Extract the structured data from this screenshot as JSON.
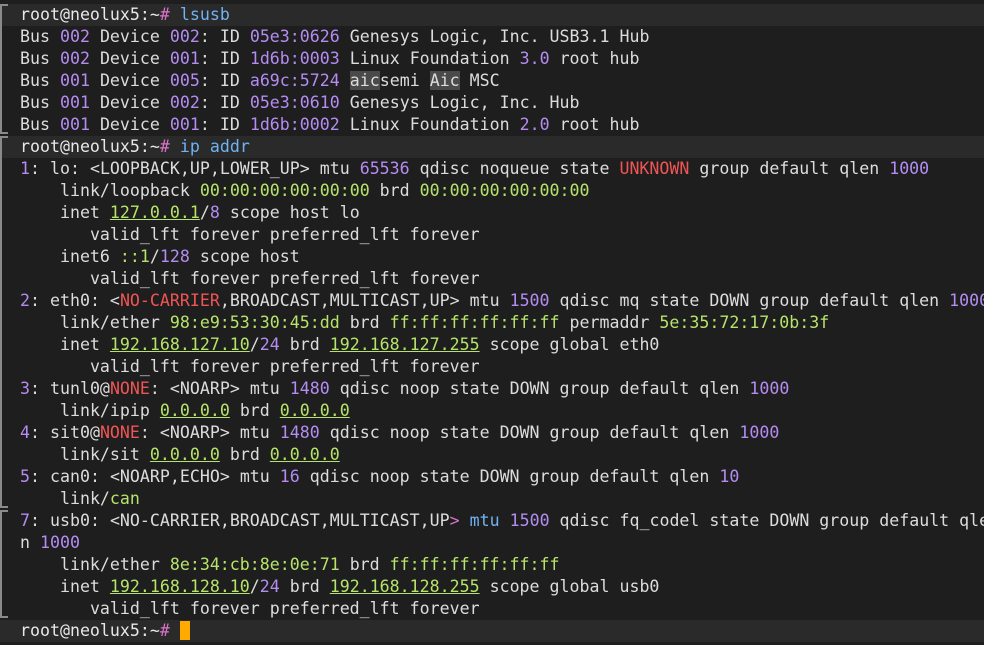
{
  "prompt": {
    "user_host": "root@neolux5:~",
    "symbol": "#"
  },
  "commands": {
    "lsusb": "lsusb",
    "ip_addr": "ip addr"
  },
  "lsusb": [
    {
      "bus": "002",
      "device": "002",
      "id": "05e3:0626",
      "desc": "Genesys Logic, Inc. USB3.1 Hub"
    },
    {
      "bus": "002",
      "device": "001",
      "id": "1d6b:0003",
      "desc_a": "Linux Foundation ",
      "ver": "3.0",
      "desc_b": " root hub"
    },
    {
      "bus": "001",
      "device": "005",
      "id": "a69c:5724",
      "vendor_hl": "aic",
      "vendor_rest": "semi",
      "prod_hl": "Aic",
      "prod_rest": " MSC"
    },
    {
      "bus": "001",
      "device": "002",
      "id": "05e3:0610",
      "desc": "Genesys Logic, Inc. Hub"
    },
    {
      "bus": "001",
      "device": "001",
      "id": "1d6b:0002",
      "desc_a": "Linux Foundation ",
      "ver": "2.0",
      "desc_b": " root hub"
    }
  ],
  "ip": {
    "lo": {
      "idx": "1",
      "name": "lo",
      "flags": "<LOOPBACK,UP,LOWER_UP>",
      "mtu": "65536",
      "qdisc_pre": " qdisc noqueue state ",
      "state": "UNKNOWN",
      "group": " group default qlen ",
      "qlen": "1000",
      "link": "link/loopback",
      "mac": "00:00:00:00:00:00",
      "brd": "00:00:00:00:00:00",
      "inet_addr": "127.0.0.1",
      "inet_pfx": "8",
      "inet_scope": " scope host lo",
      "valid": "valid_lft forever preferred_lft forever",
      "inet6_addr": "::1",
      "inet6_pfx": "128",
      "inet6_scope": " scope host"
    },
    "eth0": {
      "idx": "2",
      "name": "eth0",
      "flag_red": "NO-CARRIER",
      "flags_rest": ",BROADCAST,MULTICAST,UP",
      "mtu": "1500",
      "rest": " qdisc mq state DOWN group default qlen ",
      "qlen": "1000",
      "mac": "98:e9:53:30:45:dd",
      "brd": "ff:ff:ff:ff:ff:ff",
      "permaddr": "5e:35:72:17:0b:3f",
      "inet_addr": "192.168.127.10",
      "inet_pfx": "24",
      "inet_brd": "192.168.127.255",
      "scope": " scope global eth0",
      "valid": "valid_lft forever preferred_lft forever"
    },
    "tunl0": {
      "idx": "3",
      "name": "tunl0@",
      "peer": "NONE",
      "flags": "<NOARP>",
      "mtu": "1480",
      "rest": " qdisc noop state DOWN group default qlen ",
      "qlen": "1000",
      "link": "link/ipip",
      "addr": "0.0.0.0",
      "brd": "0.0.0.0"
    },
    "sit0": {
      "idx": "4",
      "name": "sit0@",
      "peer": "NONE",
      "flags": "<NOARP>",
      "mtu": "1480",
      "rest": " qdisc noop state DOWN group default qlen ",
      "qlen": "1000",
      "link": "link/sit",
      "addr": "0.0.0.0",
      "brd": "0.0.0.0"
    },
    "can0": {
      "idx": "5",
      "name": "can0",
      "flags": "<NOARP,ECHO>",
      "mtu": "16",
      "rest": " qdisc noop state DOWN group default qlen ",
      "qlen": "10",
      "link_a": "link/",
      "link_b": "can"
    },
    "usb0": {
      "idx": "7",
      "name": "usb0",
      "flags": "<NO-CARRIER,BROADCAST,MULTICAST,UP",
      "gt": ">",
      "mtu_kw": "mtu",
      "mtu": "1500",
      "rest": " qdisc fq_codel state DOWN group default qle",
      "wrap": "n ",
      "qlen": "1000",
      "mac": "8e:34:cb:8e:0e:71",
      "brd": "ff:ff:ff:ff:ff:ff",
      "inet_addr": "192.168.128.10",
      "inet_pfx": "24",
      "inet_brd": "192.168.128.255",
      "scope": " scope global usb0",
      "valid": "valid_lft forever preferred_lft forever"
    }
  },
  "colors": {
    "background": "#1e1e1e",
    "prompt_bg": "#2a2a2a",
    "pound": "#d974c8",
    "command": "#6fb3f2",
    "number": "#b48cf2",
    "address": "#b6e36a",
    "alert": "#f05454",
    "cursor": "#ffaa00"
  },
  "icons": {
    "cursor": "block-cursor-icon"
  }
}
